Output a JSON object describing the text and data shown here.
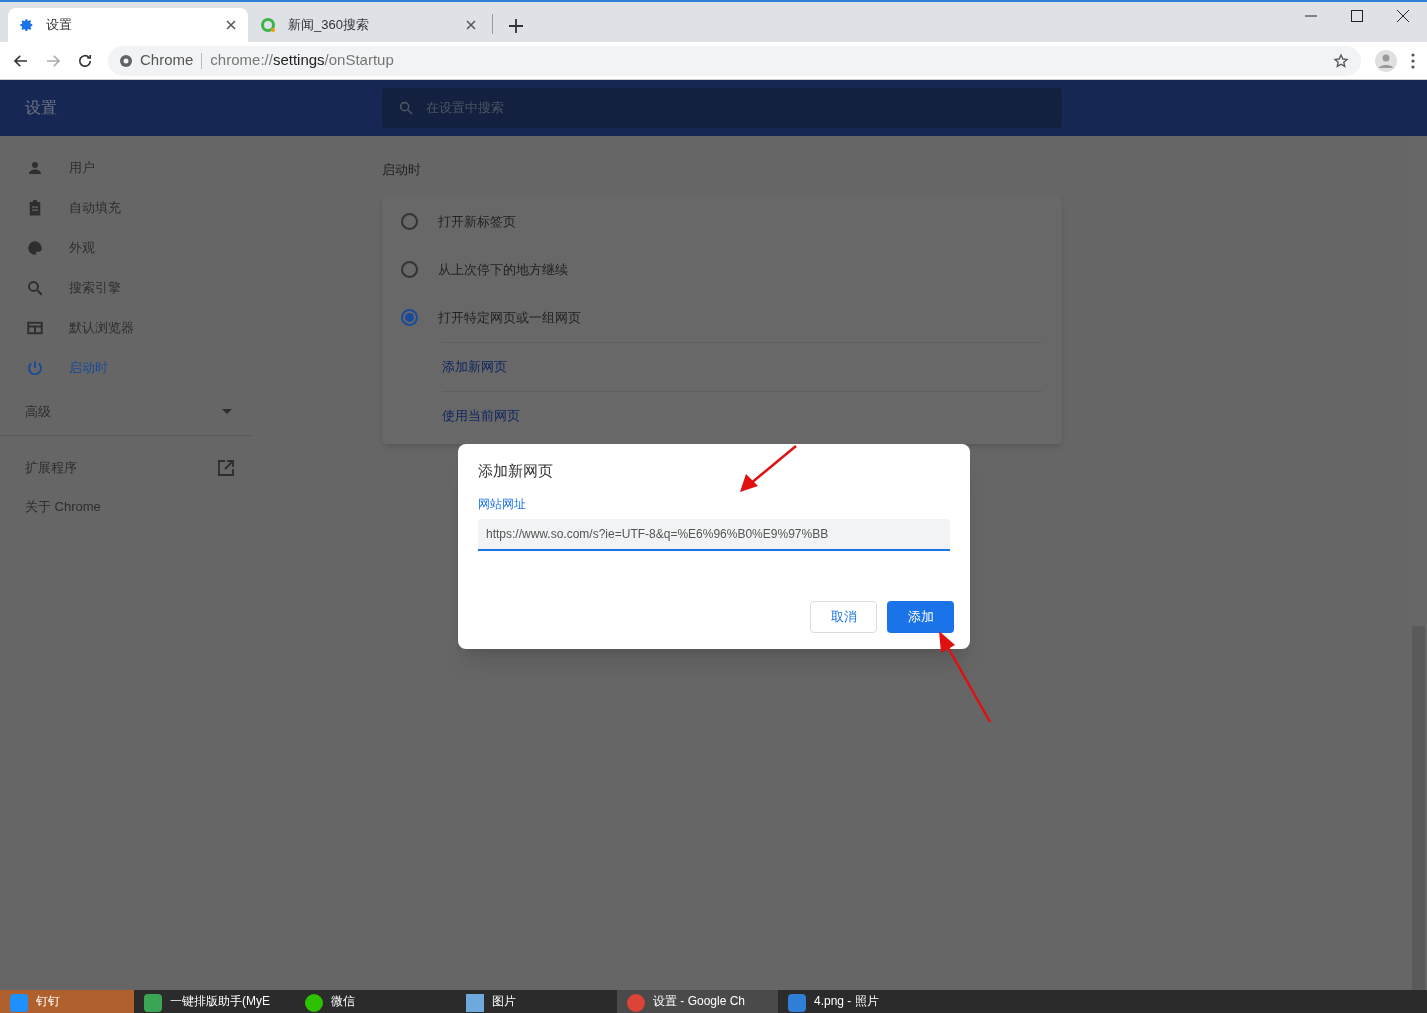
{
  "tabs": [
    {
      "title": "设置",
      "kind": "settings",
      "selected": true
    },
    {
      "title": "新闻_360搜索",
      "kind": "web",
      "selected": false
    }
  ],
  "address_bar": {
    "origin_label": "Chrome",
    "url_scheme": "chrome://",
    "url_host": "settings",
    "url_path": "/onStartup"
  },
  "header": {
    "title": "设置",
    "search_placeholder": "在设置中搜索"
  },
  "sidebar": {
    "items": [
      {
        "label": "用户",
        "selected": false
      },
      {
        "label": "自动填充",
        "selected": false
      },
      {
        "label": "外观",
        "selected": false
      },
      {
        "label": "搜索引擎",
        "selected": false
      },
      {
        "label": "默认浏览器",
        "selected": false
      },
      {
        "label": "启动时",
        "selected": true
      }
    ],
    "advanced": {
      "label": "高级",
      "expanded": false
    },
    "extensions": "扩展程序",
    "about": "关于 Chrome"
  },
  "section": {
    "title": "启动时",
    "options": [
      {
        "label": "打开新标签页",
        "selected": false
      },
      {
        "label": "从上次停下的地方继续",
        "selected": false
      },
      {
        "label": "打开特定网页或一组网页",
        "selected": true
      }
    ],
    "links": [
      "添加新网页",
      "使用当前网页"
    ]
  },
  "dialog": {
    "title": "添加新网页",
    "field_label": "网站网址",
    "field_value": "https://www.so.com/s?ie=UTF-8&q=%E6%96%B0%E9%97%BB",
    "buttons": [
      {
        "label": "取消",
        "kind": "secondary"
      },
      {
        "label": "添加",
        "kind": "primary"
      }
    ]
  },
  "taskbar": [
    {
      "label": "钉钉",
      "flashing": true,
      "active": false
    },
    {
      "label": "一键排版助手(MyE",
      "flashing": false,
      "active": false
    },
    {
      "label": "微信",
      "flashing": false,
      "active": false
    },
    {
      "label": "图片",
      "flashing": false,
      "active": false
    },
    {
      "label": "设置 - Google Ch",
      "flashing": false,
      "active": true
    },
    {
      "label": "4.png - 照片",
      "flashing": false,
      "active": false
    }
  ]
}
